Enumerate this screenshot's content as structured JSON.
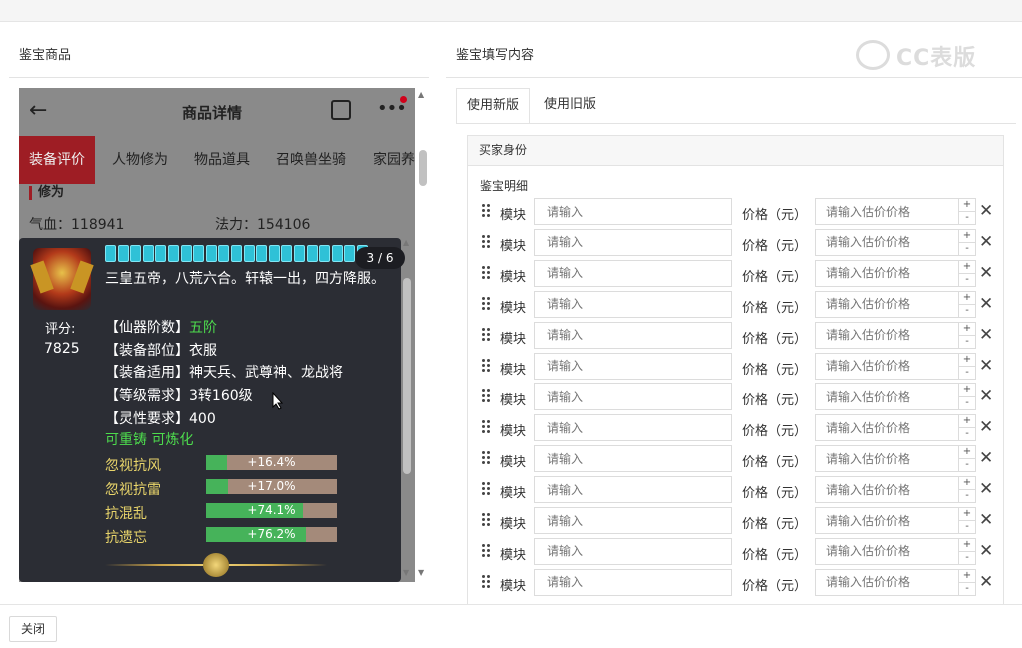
{
  "left_panel": {
    "title": "鉴宝商品"
  },
  "right_panel": {
    "title": "鉴宝填写内容"
  },
  "watermark": {
    "text": "CC表版"
  },
  "phone": {
    "header_title": "商品详情",
    "tabs": [
      "装备评价",
      "人物修为",
      "物品道具",
      "召唤兽坐骑",
      "家园养"
    ],
    "section_title": "修为",
    "stats": [
      {
        "label": "气血：",
        "value": "118941"
      },
      {
        "label": "法力：",
        "value": "154106"
      }
    ]
  },
  "item_card": {
    "page_indicator": "3 / 6",
    "description": "三皇五帝，八荒六合。轩辕一出，四方降服。",
    "score_label": "评分:",
    "score_value": "7825",
    "attributes": [
      {
        "label": "【仙器阶数】",
        "value": "五阶",
        "highlight": true
      },
      {
        "label": "【装备部位】",
        "value": "衣服",
        "highlight": false
      },
      {
        "label": "【装备适用】",
        "value": "神天兵、武尊神、龙战将",
        "highlight": false
      },
      {
        "label": "【等级需求】",
        "value": "3转160级",
        "highlight": false
      },
      {
        "label": "【灵性要求】",
        "value": "400",
        "highlight": false
      }
    ],
    "refine_text": "可重铸 可炼化",
    "resistances": [
      {
        "name": "忽视抗风",
        "value": "+16.4%",
        "fill": 0.164
      },
      {
        "name": "忽视抗雷",
        "value": "+17.0%",
        "fill": 0.17
      },
      {
        "name": "抗混乱",
        "value": "+74.1%",
        "fill": 0.741
      },
      {
        "name": "抗遗忘",
        "value": "+76.2%",
        "fill": 0.762
      }
    ]
  },
  "form": {
    "tabs": [
      {
        "label": "使用新版",
        "active": true
      },
      {
        "label": "使用旧版",
        "active": false
      }
    ],
    "buyer_section": "买家身份",
    "detail_label": "鉴宝明细",
    "row_module_label": "模块",
    "row_module_placeholder": "请输入",
    "row_price_label": "价格（元）",
    "row_price_placeholder": "请输入估价价格",
    "stepper_up": "+",
    "stepper_down": "-",
    "row_count": 13
  },
  "footer": {
    "close_label": "关闭"
  }
}
